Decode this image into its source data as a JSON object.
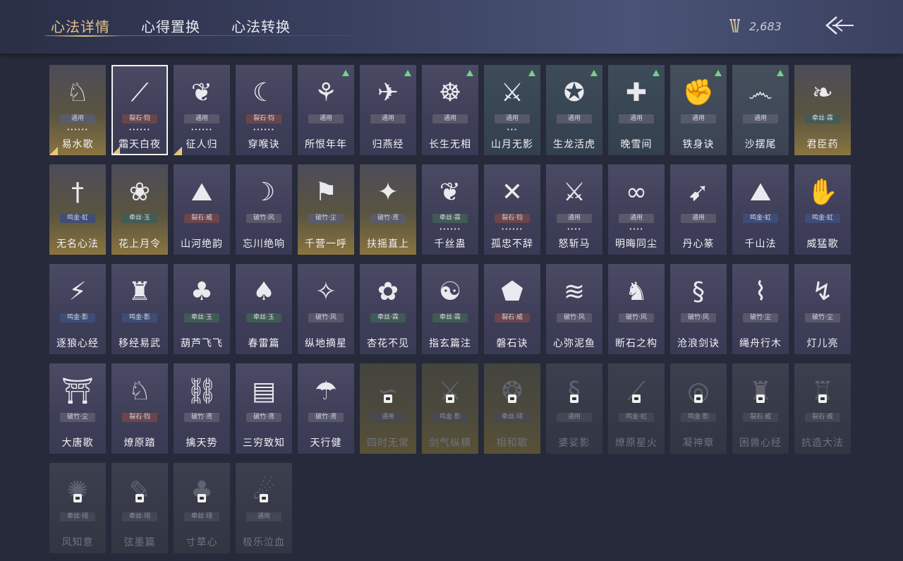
{
  "header": {
    "tabs": [
      {
        "label": "心法详情",
        "active": true
      },
      {
        "label": "心得置换",
        "active": false
      },
      {
        "label": "心法转换",
        "active": false
      }
    ],
    "currency": {
      "icon": "arrows-currency-icon",
      "value": "2,683"
    },
    "back_icon": "back-arrow-icon"
  },
  "colors": {
    "accent": "#e3c08b",
    "upgrade": "#72d48a",
    "background": "#262a3a"
  },
  "cards": [
    {
      "name": "易水歌",
      "tag": "通用",
      "dots": "••••••",
      "icon": "horse-icon",
      "glyph": "♘",
      "theme": "gold",
      "mark": true
    },
    {
      "name": "霜天白夜",
      "tag": "裂石·钧",
      "dots": "••••••",
      "icon": "spear-icon",
      "glyph": "⟋",
      "theme": "purple",
      "tagc": "red",
      "mark": true,
      "selected": true
    },
    {
      "name": "征人归",
      "tag": "通用",
      "dots": "••••••",
      "icon": "crow-icon",
      "glyph": "❦",
      "theme": "purple",
      "mark": true
    },
    {
      "name": "穿喉诀",
      "tag": "裂石·钧",
      "dots": "••••••",
      "icon": "crescent-icon",
      "glyph": "☾",
      "theme": "purple",
      "tagc": "red"
    },
    {
      "name": "所恨年年",
      "tag": "通用",
      "icon": "reed-icon",
      "glyph": "⚘",
      "theme": "purple",
      "up": true
    },
    {
      "name": "归燕经",
      "tag": "通用",
      "icon": "swallow-icon",
      "glyph": "✈",
      "theme": "purple",
      "up": true
    },
    {
      "name": "长生无相",
      "tag": "通用",
      "icon": "monk-icon",
      "glyph": "☸",
      "theme": "purple",
      "up": true
    },
    {
      "name": "山月无影",
      "tag": "通用",
      "dots": "•••",
      "icon": "blade-icon",
      "glyph": "⚔",
      "theme": "teal",
      "up": true
    },
    {
      "name": "生龙活虎",
      "tag": "通用",
      "icon": "tiger-icon",
      "glyph": "✪",
      "theme": "teal",
      "up": true
    },
    {
      "name": "晚雪间",
      "tag": "通用",
      "icon": "cross-icon",
      "glyph": "✚",
      "theme": "teal",
      "up": true
    },
    {
      "name": "铁身诀",
      "tag": "通用",
      "icon": "strongman-icon",
      "glyph": "✊",
      "theme": "green",
      "up": true
    },
    {
      "name": "沙摆尾",
      "tag": "通用",
      "icon": "wave-icon",
      "glyph": "෴",
      "theme": "green",
      "up": true
    },
    {
      "name": "君臣药",
      "tag": "牵丝·霖",
      "icon": "herb-icon",
      "glyph": "❧",
      "theme": "gold",
      "tagc": "green"
    },
    {
      "name": "无名心法",
      "tag": "鸣金·虹",
      "icon": "sword-icon",
      "glyph": "†",
      "theme": "gold",
      "tagc": "blue"
    },
    {
      "name": "花上月令",
      "tag": "牵丝·玉",
      "icon": "flower-icon",
      "glyph": "❀",
      "theme": "gold",
      "tagc": "green"
    },
    {
      "name": "山河绝韵",
      "tag": "裂石·威",
      "icon": "mountain-icon",
      "glyph": "⛰",
      "theme": "purple",
      "tagc": "red"
    },
    {
      "name": "忘川绝响",
      "tag": "破竹·风",
      "icon": "mask-icon",
      "glyph": "☽",
      "theme": "purple"
    },
    {
      "name": "千营一呼",
      "tag": "破竹·尘",
      "icon": "banner-icon",
      "glyph": "⚑",
      "theme": "gold"
    },
    {
      "name": "扶摇直上",
      "tag": "破竹·鸢",
      "icon": "eagle-icon",
      "glyph": "✦",
      "theme": "gold"
    },
    {
      "name": "千丝蛊",
      "tag": "牵丝·霖",
      "dots": "••••••",
      "icon": "leaf-icon",
      "glyph": "❦",
      "theme": "purple",
      "tagc": "green"
    },
    {
      "name": "孤忠不辞",
      "tag": "裂石·钧",
      "dots": "••••••",
      "icon": "crossed-blades-icon",
      "glyph": "✕",
      "theme": "purple",
      "tagc": "red"
    },
    {
      "name": "怒斩马",
      "tag": "通用",
      "dots": "••••",
      "icon": "broadsword-icon",
      "glyph": "⚔",
      "theme": "purple"
    },
    {
      "name": "明晦同尘",
      "tag": "通用",
      "dots": "••••",
      "icon": "knot-icon",
      "glyph": "∞",
      "theme": "purple"
    },
    {
      "name": "丹心篆",
      "tag": "通用",
      "icon": "fish-blade-icon",
      "glyph": "➹",
      "theme": "purple"
    },
    {
      "name": "千山法",
      "tag": "鸣金·虹",
      "icon": "peaks-icon",
      "glyph": "⛰",
      "theme": "purple",
      "tagc": "blue"
    },
    {
      "name": "威猛歌",
      "tag": "鸣金·虹",
      "icon": "gauntlet-icon",
      "glyph": "✋",
      "theme": "purple",
      "tagc": "blue"
    },
    {
      "name": "逐狼心经",
      "tag": "鸣金·影",
      "icon": "wolf-icon",
      "glyph": "⚡",
      "theme": "purple",
      "tagc": "blue"
    },
    {
      "name": "移经易武",
      "tag": "鸣金·影",
      "icon": "warrior-icon",
      "glyph": "♜",
      "theme": "purple",
      "tagc": "blue"
    },
    {
      "name": "葫芦飞飞",
      "tag": "牵丝·玉",
      "icon": "gourd-icon",
      "glyph": "♣",
      "theme": "purple",
      "tagc": "green"
    },
    {
      "name": "春雷篇",
      "tag": "牵丝·玉",
      "icon": "tree-icon",
      "glyph": "♠",
      "theme": "purple",
      "tagc": "green"
    },
    {
      "name": "纵地摘星",
      "tag": "破竹·风",
      "icon": "star-catch-icon",
      "glyph": "✧",
      "theme": "purple"
    },
    {
      "name": "杏花不见",
      "tag": "牵丝·霖",
      "icon": "blossom-icon",
      "glyph": "✿",
      "theme": "purple",
      "tagc": "green"
    },
    {
      "name": "指玄篇注",
      "tag": "牵丝·霖",
      "icon": "yinyang-icon",
      "glyph": "☯",
      "theme": "purple",
      "tagc": "green"
    },
    {
      "name": "磐石诀",
      "tag": "裂石·威",
      "icon": "rock-icon",
      "glyph": "⬟",
      "theme": "purple",
      "tagc": "red"
    },
    {
      "name": "心弥泥鱼",
      "tag": "破竹·风",
      "icon": "koi-icon",
      "glyph": "≋",
      "theme": "purple"
    },
    {
      "name": "断石之构",
      "tag": "破竹·风",
      "icon": "swordsman-icon",
      "glyph": "♞",
      "theme": "purple"
    },
    {
      "name": "沧浪剑诀",
      "tag": "破竹·风",
      "icon": "dragon-icon",
      "glyph": "§",
      "theme": "purple"
    },
    {
      "name": "绳舟行木",
      "tag": "破竹·尘",
      "icon": "rope-icon",
      "glyph": "⌇",
      "theme": "purple"
    },
    {
      "name": "灯儿亮",
      "tag": "破竹·尘",
      "icon": "kick-icon",
      "glyph": "↯",
      "theme": "purple"
    },
    {
      "name": "大唐歌",
      "tag": "破竹·尘",
      "icon": "palace-icon",
      "glyph": "⛩",
      "theme": "purple"
    },
    {
      "name": "燎原踏",
      "tag": "裂石·钧",
      "icon": "steed-icon",
      "glyph": "♘",
      "theme": "purple",
      "tagc": "red"
    },
    {
      "name": "擒天势",
      "tag": "破竹·鸢",
      "icon": "chain-icon",
      "glyph": "⛓",
      "theme": "purple"
    },
    {
      "name": "三穷致知",
      "tag": "破竹·鸢",
      "icon": "scroll-icon",
      "glyph": "▤",
      "theme": "purple"
    },
    {
      "name": "天行健",
      "tag": "破竹·鸢",
      "icon": "umbrella-icon",
      "glyph": "☂",
      "theme": "purple"
    },
    {
      "name": "四时无常",
      "tag": "通用",
      "icon": "seasons-icon",
      "glyph": "∽",
      "theme": "gold",
      "locked": true
    },
    {
      "name": "剑气纵横",
      "tag": "鸣金·影",
      "icon": "sword-qi-icon",
      "glyph": "⚔",
      "theme": "gold",
      "locked": true
    },
    {
      "name": "相和歌",
      "tag": "牵丝·翊",
      "icon": "phoenix-icon",
      "glyph": "❂",
      "theme": "gold",
      "locked": true
    },
    {
      "name": "婆娑影",
      "tag": "通用",
      "icon": "serpent-icon",
      "glyph": "§",
      "locked": true
    },
    {
      "name": "燎原星火",
      "tag": "鸣金·虹",
      "icon": "spear-thrust-icon",
      "glyph": "⟋",
      "locked": true
    },
    {
      "name": "凝神章",
      "tag": "鸣金·影",
      "icon": "focus-icon",
      "glyph": "◎",
      "locked": true
    },
    {
      "name": "困兽心经",
      "tag": "裂石·威",
      "icon": "beast-icon",
      "glyph": "♜",
      "locked": true
    },
    {
      "name": "抗造大法",
      "tag": "裂石·威",
      "icon": "bell-icon",
      "glyph": "♖",
      "locked": true
    },
    {
      "name": "风知意",
      "tag": "牵丝·翊",
      "icon": "wind-icon",
      "glyph": "✺",
      "locked": true
    },
    {
      "name": "弦墨篇",
      "tag": "牵丝·翊",
      "icon": "ink-icon",
      "glyph": "✎",
      "locked": true
    },
    {
      "name": "寸草心",
      "tag": "牵丝·翊",
      "icon": "grass-icon",
      "glyph": "♣",
      "locked": true
    },
    {
      "name": "极乐泣血",
      "tag": "通用",
      "icon": "comet-icon",
      "glyph": "☄",
      "locked": true
    }
  ]
}
